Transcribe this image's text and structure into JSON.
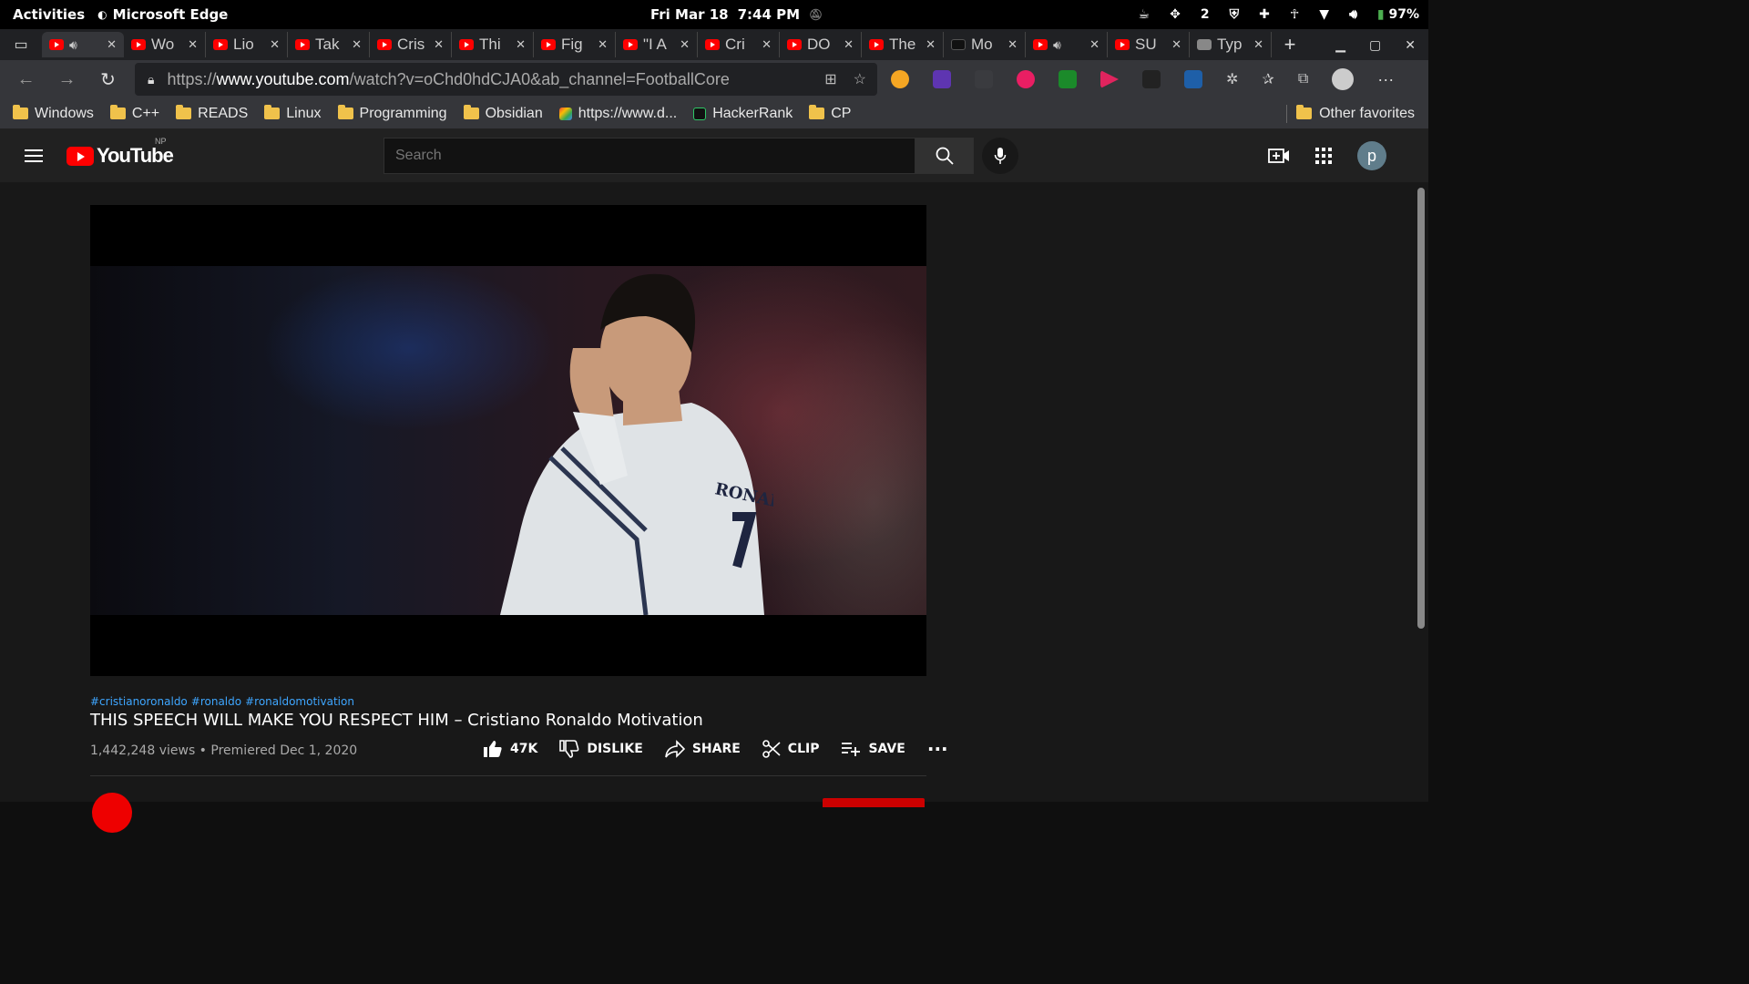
{
  "topbar": {
    "activities": "Activities",
    "app_name": "Microsoft Edge",
    "date": "Fri Mar 18",
    "time": "7:44 PM",
    "notification_count": "2",
    "battery": "97%"
  },
  "tabs": [
    {
      "title": "",
      "active": true,
      "audio": true,
      "favicon": "youtube"
    },
    {
      "title": "Wo",
      "favicon": "youtube"
    },
    {
      "title": "Lio",
      "favicon": "youtube"
    },
    {
      "title": "Tak",
      "favicon": "youtube"
    },
    {
      "title": "Cris",
      "favicon": "youtube"
    },
    {
      "title": "Thi",
      "favicon": "youtube"
    },
    {
      "title": "Fig",
      "favicon": "youtube"
    },
    {
      "title": "\"I A",
      "favicon": "youtube"
    },
    {
      "title": "Cri",
      "favicon": "youtube"
    },
    {
      "title": "DO",
      "favicon": "youtube"
    },
    {
      "title": "The",
      "favicon": "youtube"
    },
    {
      "title": "Mo",
      "favicon": "medium"
    },
    {
      "title": "",
      "audio": true,
      "favicon": "youtube"
    },
    {
      "title": "SU",
      "favicon": "youtube"
    },
    {
      "title": "Typ",
      "favicon": "monkeytype"
    }
  ],
  "address": {
    "scheme": "https://",
    "host": "www.youtube.com",
    "path": "/watch?v=oChd0hdCJA0&ab_channel=FootballCore"
  },
  "bookmarks": {
    "items": [
      {
        "label": "Windows",
        "type": "folder"
      },
      {
        "label": "C++",
        "type": "folder"
      },
      {
        "label": "READS",
        "type": "folder"
      },
      {
        "label": "Linux",
        "type": "folder"
      },
      {
        "label": "Programming",
        "type": "folder"
      },
      {
        "label": "Obsidian",
        "type": "folder"
      },
      {
        "label": "https://www.d...",
        "type": "link"
      },
      {
        "label": "HackerRank",
        "type": "link"
      },
      {
        "label": "CP",
        "type": "folder"
      }
    ],
    "other": "Other favorites"
  },
  "youtube": {
    "logo_text": "YouTube",
    "country_code": "NP",
    "search_placeholder": "Search",
    "avatar_letter": "p"
  },
  "video": {
    "hashtags": [
      "#cristianoronaldo",
      "#ronaldo",
      "#ronaldomotivation"
    ],
    "title": "THIS SPEECH WILL MAKE YOU RESPECT HIM – Cristiano Ronaldo Motivation",
    "views": "1,442,248 views",
    "premiered": "Premiered Dec 1, 2020",
    "likes": "47K",
    "dislike_label": "DISLIKE",
    "share_label": "SHARE",
    "clip_label": "CLIP",
    "save_label": "SAVE"
  },
  "colors": {
    "youtube_red": "#ff0000",
    "link_blue": "#3ea6ff",
    "folder_yellow": "#f0c24b"
  }
}
